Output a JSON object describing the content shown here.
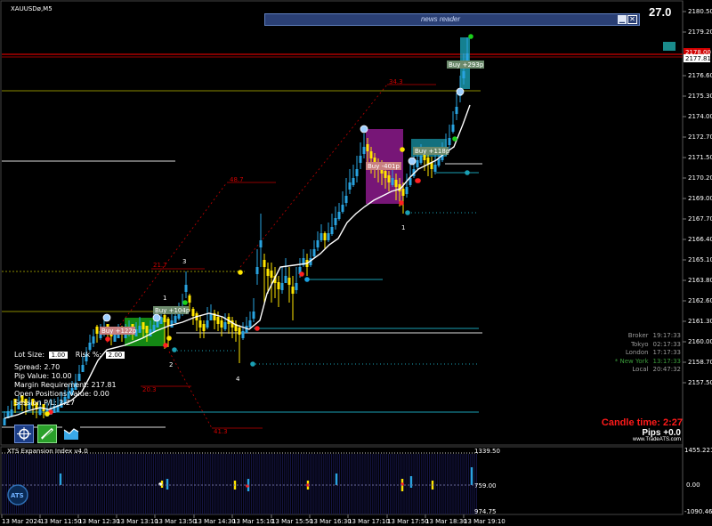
{
  "symbol": "XAUUSDø,M5",
  "spread_top": "27.0",
  "news_reader": {
    "label": "news reader"
  },
  "price_axis": {
    "ticks": [
      "2180.50",
      "2179.20",
      "2177.81",
      "2176.60",
      "2175.30",
      "2174.00",
      "2172.70",
      "2171.50",
      "2170.20",
      "2169.00",
      "2167.70",
      "2166.40",
      "2165.10",
      "2163.80",
      "2162.60",
      "2161.30",
      "2160.00",
      "2158.70",
      "2157.50"
    ],
    "current_bid": "2177.81",
    "current_ask": "2178.00"
  },
  "markers": {
    "buy1": "Buy +122p",
    "buy2": "Buy +104p",
    "buy3": "Buy -401p",
    "buy4": "Buy +118p",
    "buy5": "Buy +293p",
    "fib_a": "48.7",
    "fib_b": "34.3",
    "fib_c": "21.7",
    "fib_d": "20.3",
    "fib_e": "41.3",
    "w1": "1",
    "w2": "2",
    "w3": "3",
    "w4": "4",
    "w1b": "1"
  },
  "info_panel": {
    "lot_label": "Lot Size:",
    "lot_value": "1.00",
    "risk_label": "Risk %:",
    "risk_value": "2.00",
    "spread": "Spread: 2.70",
    "pip_value": "Pip Value: 10.00",
    "margin": "Margin Requirement: 217.81",
    "open_positions": "Open Positions Value: 0.00",
    "session_pl": "Session P/L: 2.27"
  },
  "sessions": [
    {
      "name": "Broker",
      "time": "19:17:33",
      "color": "#9a9a9a"
    },
    {
      "name": "Tokyo",
      "time": "02:17:33",
      "color": "#9a9a9a"
    },
    {
      "name": "London",
      "time": "17:17:33",
      "color": "#9a9a9a"
    },
    {
      "name": "* New York",
      "time": "13:17:33",
      "color": "#3a9a3a"
    },
    {
      "name": "Local",
      "time": "20:47:32",
      "color": "#9a9a9a"
    }
  ],
  "candle_time": {
    "label": "Candle time:",
    "value": "2:27"
  },
  "pips": "Pips +0.0",
  "brand": "www.TradeATS.com",
  "indicator": {
    "title": "XTS Expansion Index v4.0",
    "upper": "1339.50",
    "mid": "759.00",
    "lower": "974.75",
    "axis_top": "1455.2215",
    "axis_mid": "0.00",
    "axis_bottom": "-1090.462",
    "logo": "ATS"
  },
  "time_axis": [
    "13 Mar 2024",
    "13 Mar 11:50",
    "13 Mar 12:30",
    "13 Mar 13:10",
    "13 Mar 13:50",
    "13 Mar 14:30",
    "13 Mar 15:10",
    "13 Mar 15:50",
    "13 Mar 16:30",
    "13 Mar 17:10",
    "13 Mar 17:50",
    "13 Mar 18:30",
    "13 Mar 19:10"
  ],
  "colors": {
    "bull": "#29a3e0",
    "bear": "#ffe600",
    "line": "#ffffff",
    "purple": "#8c1a8c",
    "green_zone": "#1bb61b",
    "teal": "#1aa0b4",
    "red_line": "#d00000",
    "olive_line": "#8a8a00"
  }
}
